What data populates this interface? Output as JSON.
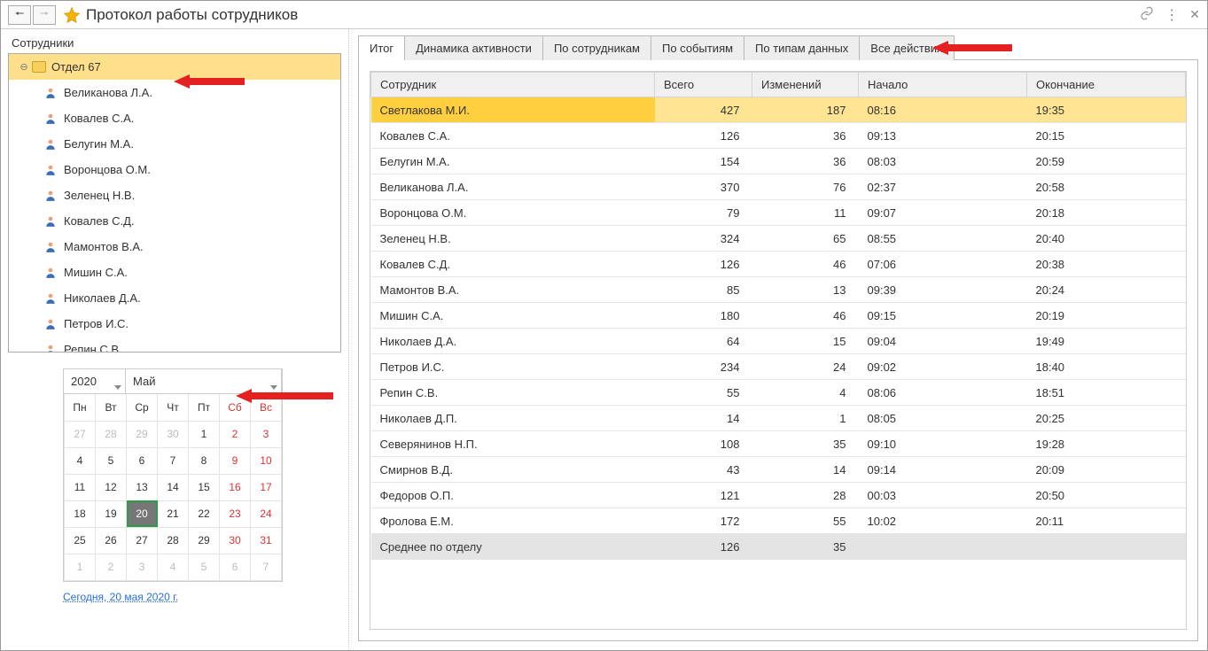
{
  "header": {
    "title": "Протокол работы сотрудников"
  },
  "sidebar": {
    "label": "Сотрудники",
    "department": "Отдел 67",
    "employees": [
      "Великанова Л.А.",
      "Ковалев С.А.",
      "Белугин М.А.",
      "Воронцова О.М.",
      "Зеленец Н.В.",
      "Ковалев С.Д.",
      "Мамонтов В.А.",
      "Мишин С.А.",
      "Николаев Д.А.",
      "Петров И.С.",
      "Репин С.В."
    ]
  },
  "calendar": {
    "year": "2020",
    "month": "Май",
    "weekdays": [
      "Пн",
      "Вт",
      "Ср",
      "Чт",
      "Пт",
      "Сб",
      "Вс"
    ],
    "weeks": [
      [
        {
          "d": "27",
          "o": true
        },
        {
          "d": "28",
          "o": true
        },
        {
          "d": "29",
          "o": true
        },
        {
          "d": "30",
          "o": true
        },
        {
          "d": "1"
        },
        {
          "d": "2",
          "w": true
        },
        {
          "d": "3",
          "w": true
        }
      ],
      [
        {
          "d": "4"
        },
        {
          "d": "5"
        },
        {
          "d": "6"
        },
        {
          "d": "7"
        },
        {
          "d": "8"
        },
        {
          "d": "9",
          "w": true
        },
        {
          "d": "10",
          "w": true
        }
      ],
      [
        {
          "d": "11"
        },
        {
          "d": "12"
        },
        {
          "d": "13"
        },
        {
          "d": "14"
        },
        {
          "d": "15"
        },
        {
          "d": "16",
          "w": true
        },
        {
          "d": "17",
          "w": true
        }
      ],
      [
        {
          "d": "18"
        },
        {
          "d": "19"
        },
        {
          "d": "20",
          "t": true
        },
        {
          "d": "21"
        },
        {
          "d": "22"
        },
        {
          "d": "23",
          "w": true
        },
        {
          "d": "24",
          "w": true
        }
      ],
      [
        {
          "d": "25"
        },
        {
          "d": "26"
        },
        {
          "d": "27"
        },
        {
          "d": "28"
        },
        {
          "d": "29"
        },
        {
          "d": "30",
          "w": true
        },
        {
          "d": "31",
          "w": true
        }
      ],
      [
        {
          "d": "1",
          "o": true
        },
        {
          "d": "2",
          "o": true
        },
        {
          "d": "3",
          "o": true
        },
        {
          "d": "4",
          "o": true
        },
        {
          "d": "5",
          "o": true
        },
        {
          "d": "6",
          "o": true
        },
        {
          "d": "7",
          "o": true
        }
      ]
    ],
    "today_link": "Сегодня, 20 мая 2020 г."
  },
  "tabs": [
    "Итог",
    "Динамика активности",
    "По сотрудникам",
    "По событиям",
    "По типам данных",
    "Все действия"
  ],
  "grid": {
    "columns": [
      "Сотрудник",
      "Всего",
      "Изменений",
      "Начало",
      "Окончание"
    ],
    "rows": [
      {
        "name": "Светлакова М.И.",
        "total": "427",
        "changes": "187",
        "start": "08:16",
        "end": "19:35",
        "sel": true
      },
      {
        "name": "Ковалев С.А.",
        "total": "126",
        "changes": "36",
        "start": "09:13",
        "end": "20:15"
      },
      {
        "name": "Белугин М.А.",
        "total": "154",
        "changes": "36",
        "start": "08:03",
        "end": "20:59"
      },
      {
        "name": "Великанова Л.А.",
        "total": "370",
        "changes": "76",
        "start": "02:37",
        "end": "20:58"
      },
      {
        "name": "Воронцова О.М.",
        "total": "79",
        "changes": "11",
        "start": "09:07",
        "end": "20:18"
      },
      {
        "name": "Зеленец Н.В.",
        "total": "324",
        "changes": "65",
        "start": "08:55",
        "end": "20:40"
      },
      {
        "name": "Ковалев С.Д.",
        "total": "126",
        "changes": "46",
        "start": "07:06",
        "end": "20:38"
      },
      {
        "name": "Мамонтов В.А.",
        "total": "85",
        "changes": "13",
        "start": "09:39",
        "end": "20:24"
      },
      {
        "name": "Мишин С.А.",
        "total": "180",
        "changes": "46",
        "start": "09:15",
        "end": "20:19"
      },
      {
        "name": "Николаев Д.А.",
        "total": "64",
        "changes": "15",
        "start": "09:04",
        "end": "19:49"
      },
      {
        "name": "Петров И.С.",
        "total": "234",
        "changes": "24",
        "start": "09:02",
        "end": "18:40"
      },
      {
        "name": "Репин С.В.",
        "total": "55",
        "changes": "4",
        "start": "08:06",
        "end": "18:51"
      },
      {
        "name": "Николаев Д.П.",
        "total": "14",
        "changes": "1",
        "start": "08:05",
        "end": "20:25"
      },
      {
        "name": "Северянинов Н.П.",
        "total": "108",
        "changes": "35",
        "start": "09:10",
        "end": "19:28"
      },
      {
        "name": "Смирнов В.Д.",
        "total": "43",
        "changes": "14",
        "start": "09:14",
        "end": "20:09"
      },
      {
        "name": "Федоров О.П.",
        "total": "121",
        "changes": "28",
        "start": "00:03",
        "end": "20:50"
      },
      {
        "name": "Фролова Е.М.",
        "total": "172",
        "changes": "55",
        "start": "10:02",
        "end": "20:11"
      }
    ],
    "footer": {
      "name": "Среднее по отделу",
      "total": "126",
      "changes": "35",
      "start": "",
      "end": ""
    }
  }
}
